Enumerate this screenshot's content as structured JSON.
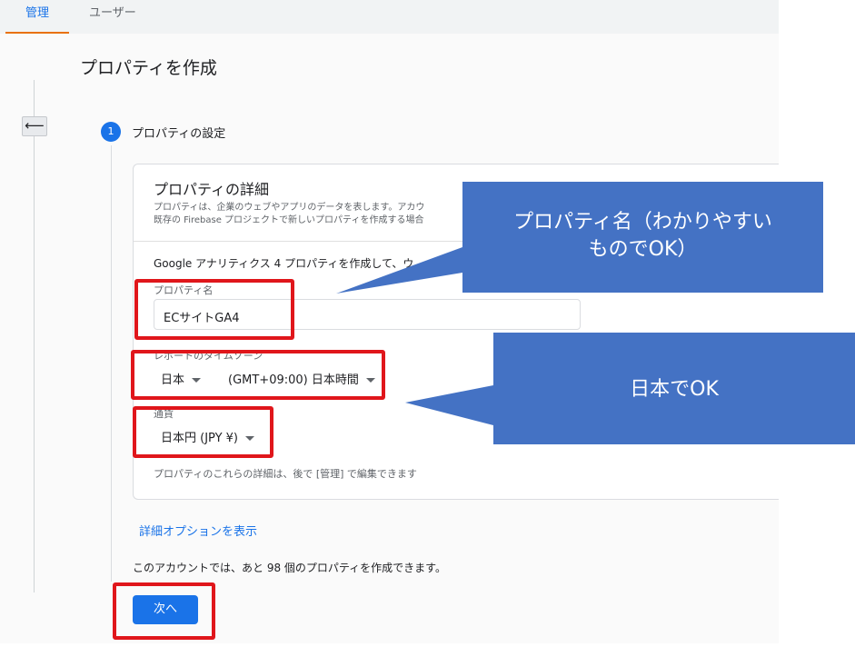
{
  "tabs": {
    "admin": "管理",
    "user": "ユーザー"
  },
  "page": {
    "title": "プロパティを作成"
  },
  "back_button": {
    "icon": "arrow-left-icon",
    "glyph": "⟵"
  },
  "step": {
    "number": "1",
    "title": "プロパティの設定"
  },
  "card": {
    "title": "プロパティの詳細",
    "desc1": "プロパティは、企業のウェブやアプリのデータを表します。アカウ",
    "desc2": "既存の Firebase プロジェクトで新しいプロパティを作成する場合",
    "create_line": "Google アナリティクス 4 プロパティを作成して、ウ",
    "name_label": "プロパティ名",
    "name_value": "ECサイトGA4",
    "timezone_label": "レポートのタイムゾーン",
    "country_value": "日本",
    "timezone_value": "(GMT+09:00) 日本時間",
    "currency_label": "通貨",
    "currency_value": "日本円 (JPY ¥)",
    "note": "プロパティのこれらの詳細は、後で [管理] で編集できます"
  },
  "advanced_link": "詳細オプションを表示",
  "quota": "このアカウントでは、あと 98 個のプロパティを作成できます。",
  "next_button": "次へ",
  "annotations": {
    "name_callout_line1": "プロパティ名（わかりやすい",
    "name_callout_line2": "ものでOK）",
    "timezone_callout": "日本でOK"
  },
  "colors": {
    "accent": "#1a73e8",
    "highlight": "#e0161b",
    "callout": "#4472c4",
    "tab_underline": "#e8710a"
  }
}
